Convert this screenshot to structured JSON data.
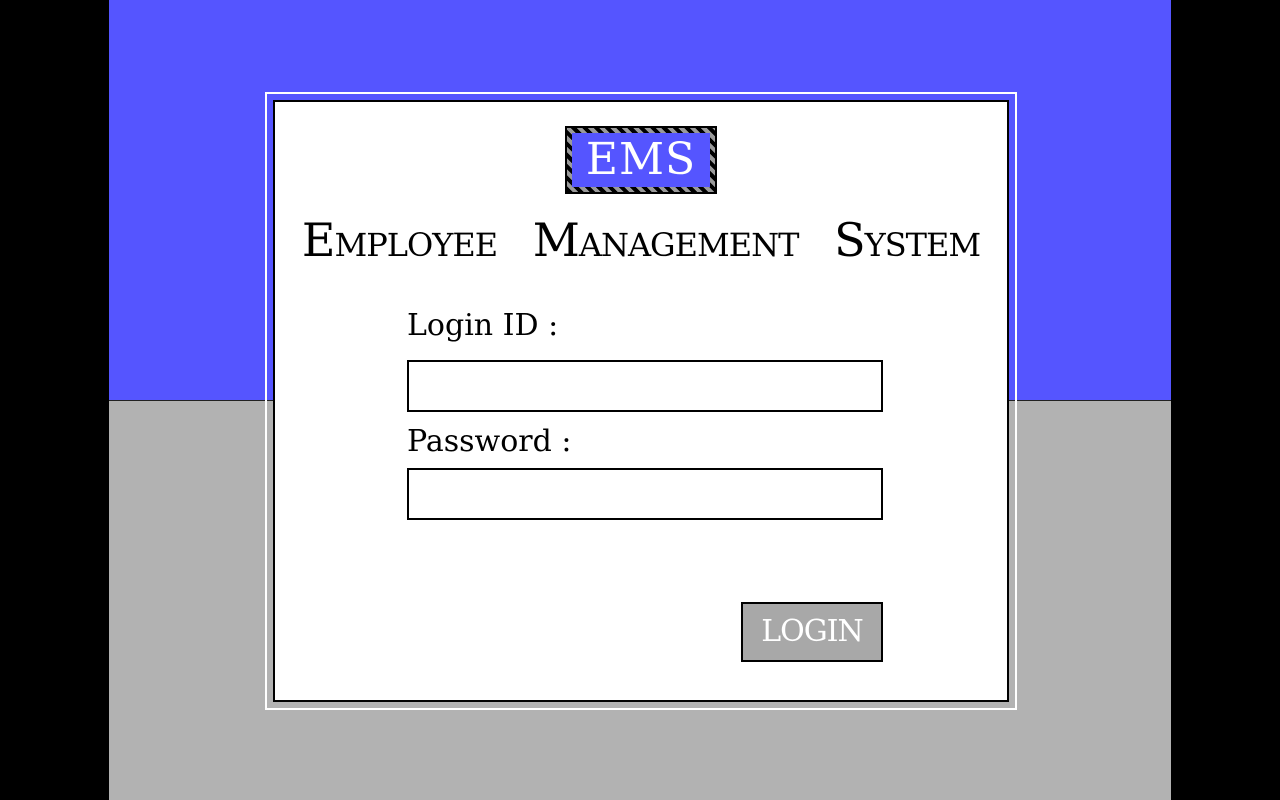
{
  "app": {
    "logo_text": "EMS",
    "title": "Employee Management System"
  },
  "form": {
    "login_id_label": "Login ID :",
    "login_id_value": "",
    "password_label": "Password :",
    "password_value": "",
    "login_button_label": "LOGIN"
  },
  "colors": {
    "top_background": "#5555ff",
    "bottom_background": "#b2b2b2",
    "panel": "#ffffff",
    "logo_background": "#5555ff",
    "button_background": "#a8a8a8",
    "outer_background": "#000000"
  }
}
